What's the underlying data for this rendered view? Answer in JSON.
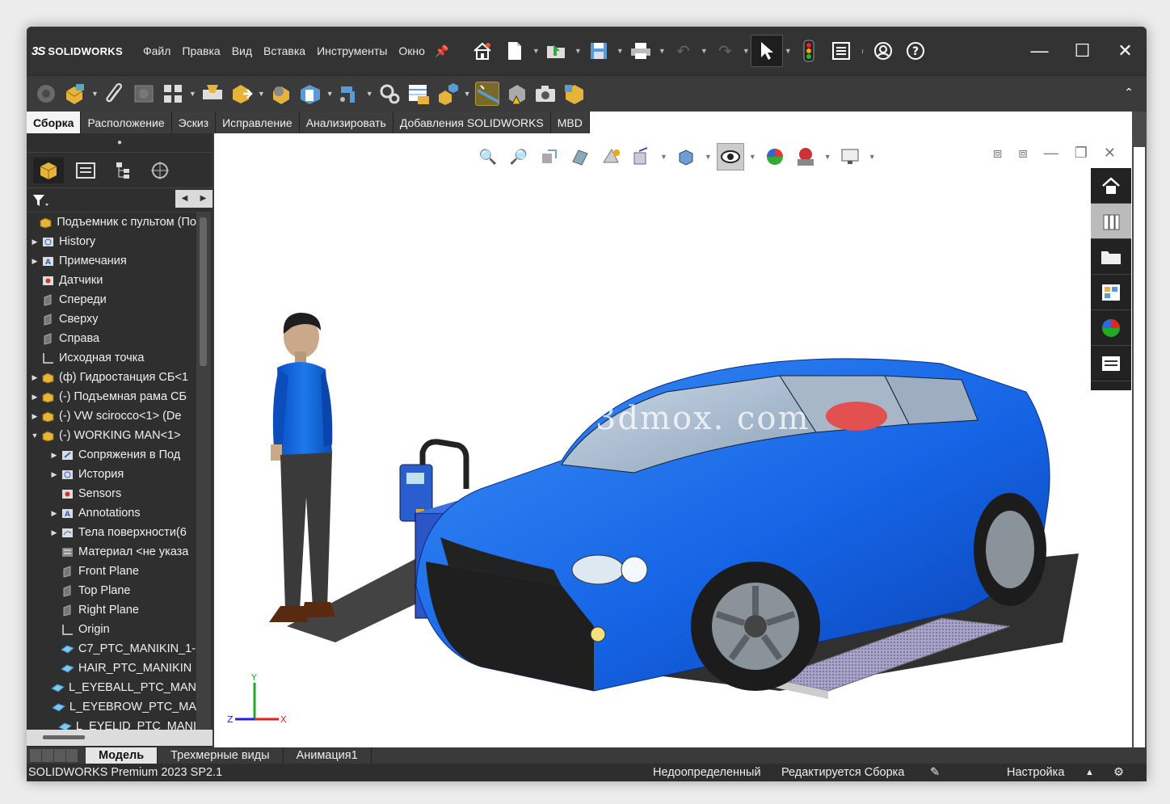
{
  "app": {
    "name": "SOLIDWORKS",
    "logo_mark": "3S"
  },
  "menu": [
    "Файл",
    "Правка",
    "Вид",
    "Вставка",
    "Инструменты",
    "Окно"
  ],
  "ribbon_tabs": [
    {
      "label": "Сборка",
      "active": true
    },
    {
      "label": "Расположение",
      "active": false
    },
    {
      "label": "Эскиз",
      "active": false
    },
    {
      "label": "Исправление",
      "active": false
    },
    {
      "label": "Анализировать",
      "active": false
    },
    {
      "label": "Добавления SOLIDWORKS",
      "active": false
    },
    {
      "label": "MBD",
      "active": false
    }
  ],
  "feature_tree": [
    {
      "label": "Подъемник с пультом (По",
      "indent": 0,
      "arrow": "",
      "icon": "assembly-icon"
    },
    {
      "label": "History",
      "indent": 1,
      "arrow": "▶",
      "icon": "history-icon"
    },
    {
      "label": "Примечания",
      "indent": 1,
      "arrow": "▶",
      "icon": "annotations-icon"
    },
    {
      "label": "Датчики",
      "indent": 1,
      "arrow": "",
      "icon": "sensors-icon"
    },
    {
      "label": "Спереди",
      "indent": 1,
      "arrow": "",
      "icon": "plane-icon"
    },
    {
      "label": "Сверху",
      "indent": 1,
      "arrow": "",
      "icon": "plane-icon"
    },
    {
      "label": "Справа",
      "indent": 1,
      "arrow": "",
      "icon": "plane-icon"
    },
    {
      "label": "Исходная точка",
      "indent": 1,
      "arrow": "",
      "icon": "origin-icon"
    },
    {
      "label": "(ф) Гидростанция СБ<1",
      "indent": 1,
      "arrow": "▶",
      "icon": "assembly-icon"
    },
    {
      "label": "(-) Подъемная рама СБ",
      "indent": 1,
      "arrow": "▶",
      "icon": "assembly-icon"
    },
    {
      "label": "(-) VW scirocco<1> (De",
      "indent": 1,
      "arrow": "▶",
      "icon": "assembly-icon"
    },
    {
      "label": "(-) WORKING MAN<1>",
      "indent": 1,
      "arrow": "▼",
      "icon": "assembly-icon"
    },
    {
      "label": "Сопряжения в Под",
      "indent": 2,
      "arrow": "▶",
      "icon": "mates-icon"
    },
    {
      "label": "История",
      "indent": 2,
      "arrow": "▶",
      "icon": "history-icon"
    },
    {
      "label": "Sensors",
      "indent": 2,
      "arrow": "",
      "icon": "sensors-icon"
    },
    {
      "label": "Annotations",
      "indent": 2,
      "arrow": "▶",
      "icon": "annotations-icon"
    },
    {
      "label": "Тела поверхности(6",
      "indent": 2,
      "arrow": "▶",
      "icon": "surface-bodies-icon"
    },
    {
      "label": "Материал <не указа",
      "indent": 2,
      "arrow": "",
      "icon": "material-icon"
    },
    {
      "label": "Front Plane",
      "indent": 2,
      "arrow": "",
      "icon": "plane-icon"
    },
    {
      "label": "Top Plane",
      "indent": 2,
      "arrow": "",
      "icon": "plane-icon"
    },
    {
      "label": "Right Plane",
      "indent": 2,
      "arrow": "",
      "icon": "plane-icon"
    },
    {
      "label": "Origin",
      "indent": 2,
      "arrow": "",
      "icon": "origin-icon"
    },
    {
      "label": "C7_PTC_MANIKIN_1-",
      "indent": 2,
      "arrow": "",
      "icon": "surface-icon"
    },
    {
      "label": "HAIR_PTC_MANIKIN",
      "indent": 2,
      "arrow": "",
      "icon": "surface-icon"
    },
    {
      "label": "L_EYEBALL_PTC_MAN",
      "indent": 2,
      "arrow": "",
      "icon": "surface-icon"
    },
    {
      "label": "L_EYEBROW_PTC_MA",
      "indent": 2,
      "arrow": "",
      "icon": "surface-icon"
    },
    {
      "label": "L_EYELID_PTC_MANI",
      "indent": 2,
      "arrow": "",
      "icon": "surface-icon"
    }
  ],
  "viewport": {
    "watermark": "3dmox. com",
    "triad": {
      "x": "X",
      "y": "Y",
      "z": "Z"
    }
  },
  "bottom_tabs": [
    {
      "label": "Модель",
      "active": true
    },
    {
      "label": "Трехмерные виды",
      "active": false
    },
    {
      "label": "Анимация1",
      "active": false
    }
  ],
  "status": {
    "version": "SOLIDWORKS Premium 2023 SP2.1",
    "definition": "Недоопределенный",
    "mode": "Редактируется Сборка",
    "settings": "Настройка"
  },
  "colors": {
    "car_body": "#1560e0",
    "accent": "#f2a100",
    "ui_dark": "#333333"
  }
}
